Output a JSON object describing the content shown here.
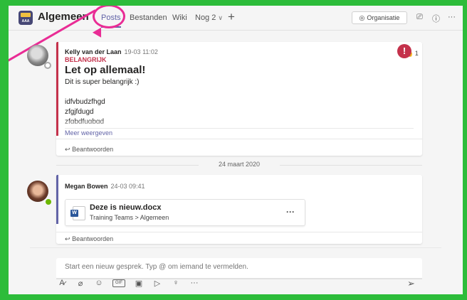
{
  "header": {
    "logo_text": "AAA",
    "team_name": "Algemeen",
    "tabs": [
      {
        "label": "Posts",
        "active": true
      },
      {
        "label": "Bestanden",
        "active": false
      },
      {
        "label": "Wiki",
        "active": false
      },
      {
        "label": "Nog 2",
        "active": false
      }
    ],
    "org_button": "Organisatie"
  },
  "messages": [
    {
      "author": "Kelly van der Laan",
      "time": "19-03 11:02",
      "importance": "BELANGRIJK",
      "subject": "Let op allemaal!",
      "lines": [
        "Dit is super belangrijk :)",
        "",
        "idfvbudzfhgd",
        "zfgjfdugd",
        "zfgbdfugbgd"
      ],
      "show_more": "Meer weergeven",
      "reply": "Beantwoorden",
      "reaction": {
        "icon": "thumbs-up",
        "count": "1"
      },
      "alert": "!"
    },
    {
      "author": "Megan Bowen",
      "time": "24-03 09:41",
      "file": {
        "name": "Deze is nieuw.docx",
        "path": "Training Teams > Algemeen",
        "more": "···",
        "type_letter": "W"
      },
      "reply": "Beantwoorden"
    }
  ],
  "date_divider": "24 maart 2020",
  "compose": {
    "placeholder": "Start een nieuw gesprek. Typ @ om iemand te vermelden."
  },
  "toolbar_icons": [
    "format-icon",
    "attach-icon",
    "emoji-icon",
    "gif-icon",
    "sticker-icon",
    "meet-icon",
    "praise-icon",
    "more-icon",
    "send-icon"
  ],
  "colors": {
    "accent": "#6264a7",
    "important": "#c4314b",
    "highlight": "#e92c95",
    "frame": "#2dbc3a"
  }
}
